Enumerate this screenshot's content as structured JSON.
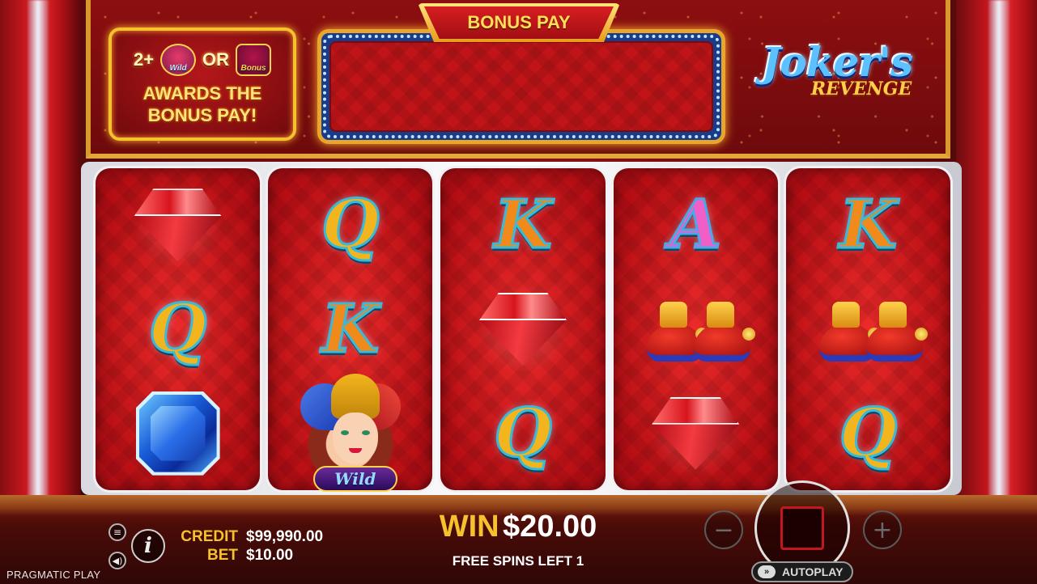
{
  "header": {
    "award_prefix": "2+",
    "award_or": "OR",
    "award_wild_badge": "Wild",
    "award_bonus_badge": "Bonus",
    "award_line1": "AWARDS THE",
    "award_line2": "BONUS PAY!",
    "bonus_title": "BONUS PAY",
    "logo_line1": "Joker's",
    "logo_line2": "REVENGE"
  },
  "reels": [
    [
      "ruby-icon",
      "q",
      "sapphire-icon"
    ],
    [
      "q",
      "k",
      "wild"
    ],
    [
      "k",
      "ruby-icon",
      "q"
    ],
    [
      "a",
      "shoes-icon",
      "ruby-icon"
    ],
    [
      "k",
      "shoes-icon",
      "q"
    ]
  ],
  "symbols": {
    "q": "Q",
    "k": "K",
    "a": "A",
    "wild_label": "Wild"
  },
  "bottom": {
    "brand": "PRAGMATIC PLAY",
    "credit_label": "CREDIT",
    "credit_value": "$99,990.00",
    "bet_label": "BET",
    "bet_value": "$10.00",
    "win_label": "WIN",
    "win_value": "$20.00",
    "free_spins": "FREE SPINS LEFT 1",
    "autoplay_label": "AUTOPLAY",
    "menu_icon": "≡",
    "sound_icon": "🔊",
    "info_icon": "i",
    "minus_icon": "−",
    "plus_icon": "+"
  },
  "colors": {
    "accent_gold": "#f5c12d",
    "reel_red": "#d81e22",
    "text_white": "#ffffff"
  }
}
